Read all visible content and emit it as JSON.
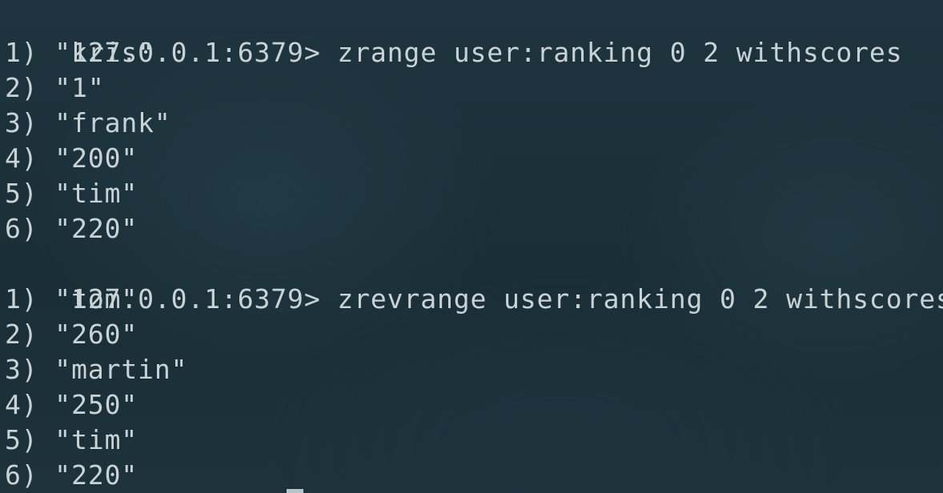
{
  "session1": {
    "prompt": "127.0.0.1:6379>",
    "command": " zrange user:ranking 0 2 withscores",
    "results": [
      "1) \"kris\"",
      "2) \"1\"",
      "3) \"frank\"",
      "4) \"200\"",
      "5) \"tim\"",
      "6) \"220\""
    ]
  },
  "session2": {
    "prompt": "127.0.0.1:6379>",
    "command": " zrevrange user:ranking 0 2 withscores",
    "results": [
      "1) \"tom\"",
      "2) \"260\"",
      "3) \"martin\"",
      "4) \"250\"",
      "5) \"tim\"",
      "6) \"220\""
    ]
  }
}
